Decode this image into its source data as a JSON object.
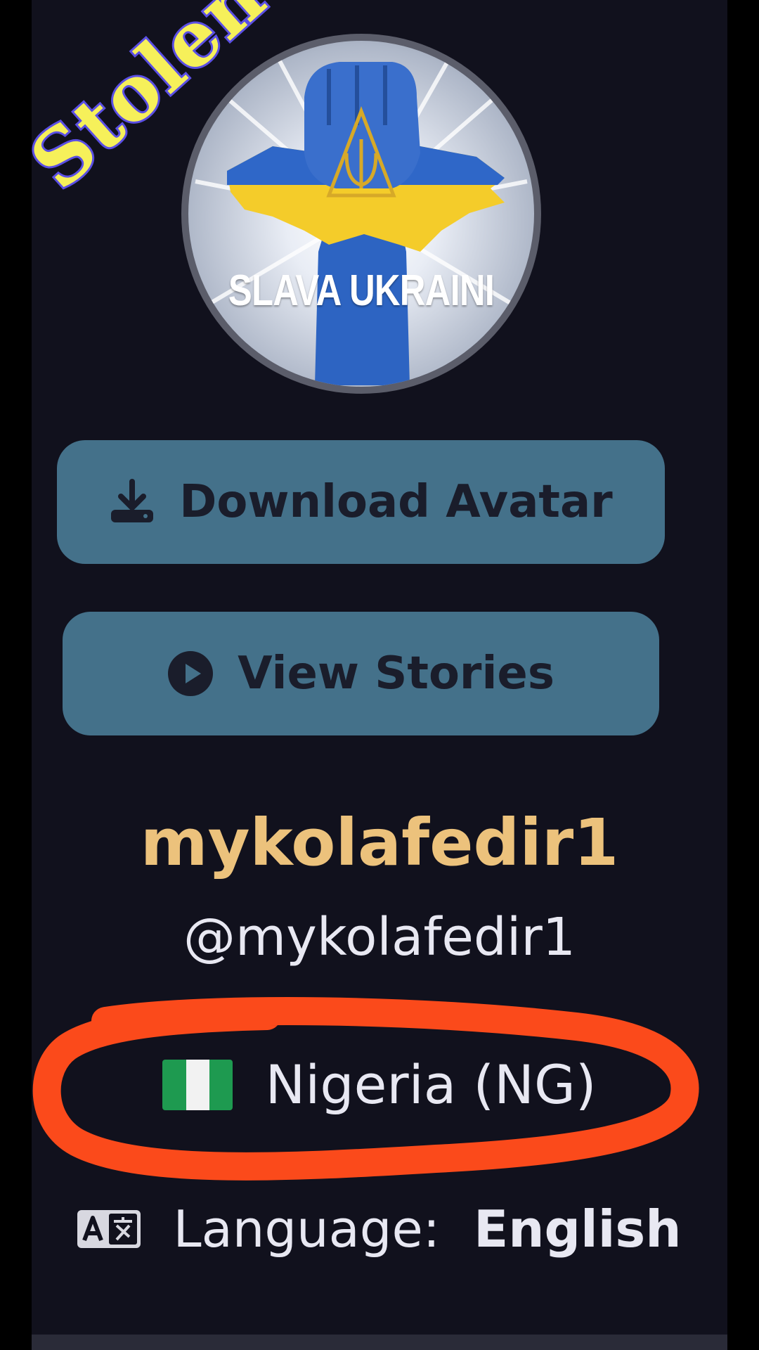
{
  "overlay": {
    "stamp_text": "Stolen",
    "stamp_color": "#f6f05a",
    "stamp_outline": "#5b4fe4"
  },
  "avatar": {
    "caption": "SLAVA UKRAINI",
    "icon": "raised-fist-ukraine-map"
  },
  "actions": {
    "download_label": "Download Avatar",
    "download_icon": "download-icon",
    "stories_label": "View Stories",
    "stories_icon": "play-circle-icon",
    "button_color": "#44718a"
  },
  "profile": {
    "display_name": "mykolafedir1",
    "handle": "@mykolafedir1",
    "country": "Nigeria (NG)",
    "country_flag": "nigeria-flag-icon",
    "language_label": "Language:",
    "language_value": "English",
    "language_icon": "translate-icon"
  },
  "colors": {
    "background": "#11111d",
    "display_name": "#ecc27c",
    "annotation": "#fb4a1b"
  }
}
